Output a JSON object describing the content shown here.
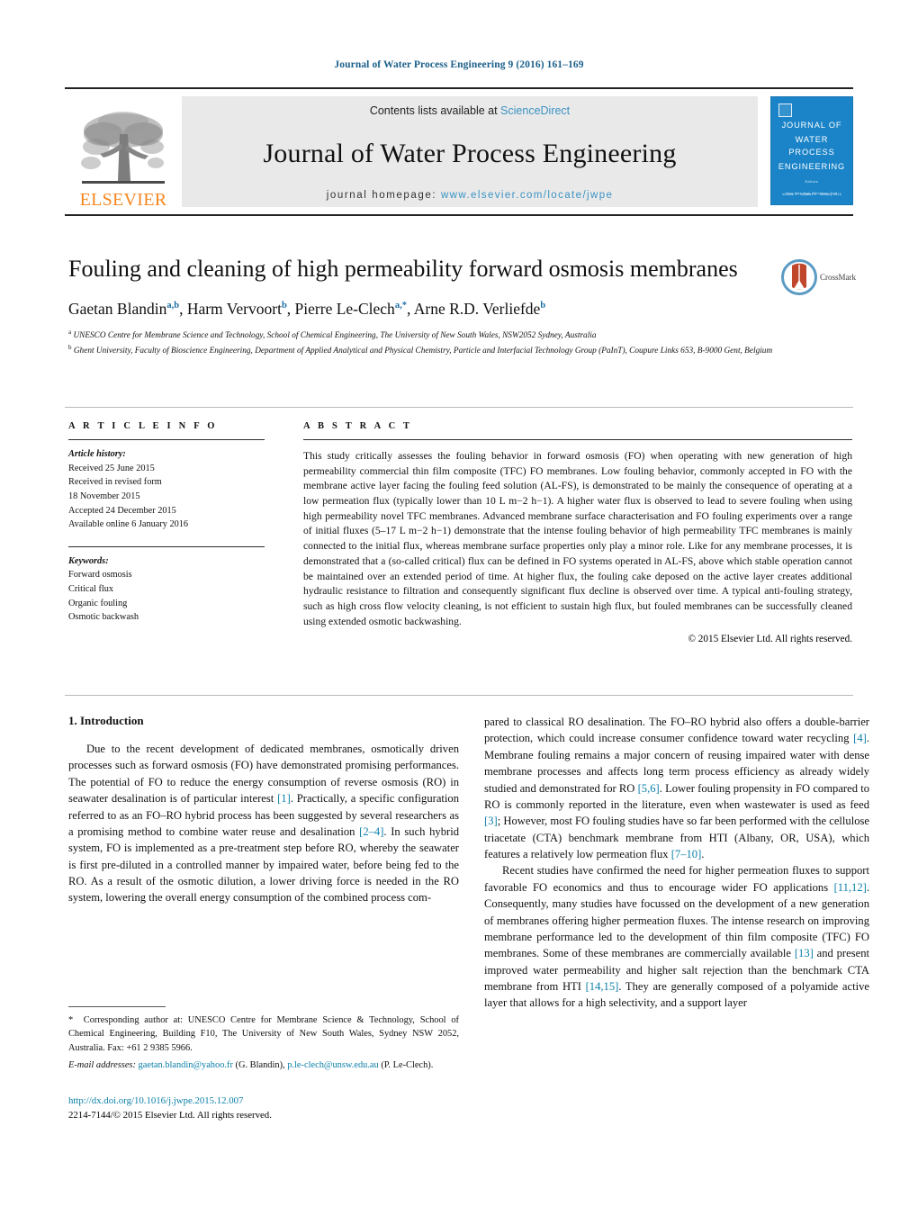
{
  "running_head": "Journal of Water Process Engineering 9 (2016) 161–169",
  "masthead": {
    "contents_prefix": "Contents lists available at ",
    "sciencedirect": "ScienceDirect",
    "journal_name": "Journal of Water Process Engineering",
    "homepage_label": "journal homepage:",
    "homepage_url": "www.elsevier.com/locate/jwpe",
    "publisher": "ELSEVIER",
    "publisher_logo_icon": "elsevier-tree-icon",
    "cover": {
      "title_line1": "JOURNAL OF",
      "title_line2": "WATER PROCESS",
      "title_line3": "ENGINEERING",
      "editors_label": "Editors",
      "editors": "Huu Hao Ngo    Wenshan Guo",
      "footer": "Volume 9 · Number 1 · January 2016"
    },
    "accent_blue": "#3a93c4",
    "cover_blue": "#1b84c8",
    "elsevier_orange": "#F6861F"
  },
  "article": {
    "title": "Fouling and cleaning of high permeability forward osmosis membranes",
    "authors_html": "Gaetan Blandin<sup>a,b</sup>, Harm Vervoort<sup>b</sup>, Pierre Le-Clech<sup>a,*</sup>, Arne R.D. Verliefde<sup>b</sup>",
    "affiliations": [
      "UNESCO Centre for Membrane Science and Technology, School of Chemical Engineering, The University of New South Wales, NSW2052 Sydney, Australia",
      "Ghent University, Faculty of Bioscience Engineering, Department of Applied Analytical and Physical Chemistry, Particle and Interfacial Technology Group (PaInT), Coupure Links 653, B-9000 Gent, Belgium"
    ],
    "crossmark_label": "CrossMark",
    "crossmark_icon": "crossmark-icon"
  },
  "article_info": {
    "heading": "A R T I C L E    I N F O",
    "history_label": "Article history:",
    "history": [
      "Received 25 June 2015",
      "Received in revised form",
      "18 November 2015",
      "Accepted 24 December 2015",
      "Available online 6 January 2016"
    ],
    "keywords_label": "Keywords:",
    "keywords": [
      "Forward osmosis",
      "Critical flux",
      "Organic fouling",
      "Osmotic backwash"
    ]
  },
  "abstract": {
    "heading": "A B S T R A C T",
    "text": "This study critically assesses the fouling behavior in forward osmosis (FO) when operating with new generation of high permeability commercial thin film composite (TFC) FO membranes. Low fouling behavior, commonly accepted in FO with the membrane active layer facing the fouling feed solution (AL-FS), is demonstrated to be mainly the consequence of operating at a low permeation flux (typically lower than 10 L m−2 h−1). A higher water flux is observed to lead to severe fouling when using high permeability novel TFC membranes. Advanced membrane surface characterisation and FO fouling experiments over a range of initial fluxes (5–17 L m−2 h−1) demonstrate that the intense fouling behavior of high permeability TFC membranes is mainly connected to the initial flux, whereas membrane surface properties only play a minor role. Like for any membrane processes, it is demonstrated that a (so-called critical) flux can be defined in FO systems operated in AL-FS, above which stable operation cannot be maintained over an extended period of time. At higher flux, the fouling cake deposed on the active layer creates additional hydraulic resistance to filtration and consequently significant flux decline is observed over time. A typical anti-fouling strategy, such as high cross flow velocity cleaning, is not efficient to sustain high flux, but fouled membranes can be successfully cleaned using extended osmotic backwashing.",
    "copyright": "© 2015 Elsevier Ltd. All rights reserved."
  },
  "introduction": {
    "heading": "1.  Introduction",
    "left_para1_html": "Due to the recent development of dedicated membranes, osmotically driven processes such as forward osmosis (FO) have demonstrated promising performances. The potential of FO to reduce the energy consumption of reverse osmosis (RO) in seawater desalination is of particular interest <span class=\"ref\">[1]</span>. Practically, a specific configuration referred to as an FO–RO hybrid process has been suggested by several researchers as a promising method to combine water reuse and desalination <span class=\"ref\">[2–4]</span>. In such hybrid system, FO is implemented as a pre-treatment step before RO, whereby the seawater is first pre-diluted in a controlled manner by impaired water, before being fed to the RO. As a result of the osmotic dilution, a lower driving force is needed in the RO system, lowering the overall energy consumption of the combined process com-",
    "right_para1_html": "pared to classical RO desalination. The FO–RO hybrid also offers a double-barrier protection, which could increase consumer confidence toward water recycling <span class=\"ref\">[4]</span>. Membrane fouling remains a major concern of reusing impaired water with dense membrane processes and affects long term process efficiency as already widely studied and demonstrated for RO <span class=\"ref\">[5,6]</span>. Lower fouling propensity in FO compared to RO is commonly reported in the literature, even when wastewater is used as feed <span class=\"ref\">[3]</span>; However, most FO fouling studies have so far been performed with the cellulose triacetate (CTA) benchmark membrane from HTI (Albany, OR, USA), which features a relatively low permeation flux <span class=\"ref\">[7–10]</span>.",
    "right_para2_html": "Recent studies have confirmed the need for higher permeation fluxes to support favorable FO economics and thus to encourage wider FO applications <span class=\"ref\">[11,12]</span>. Consequently, many studies have focussed on the development of a new generation of membranes offering higher permeation fluxes. The intense research on improving membrane performance led to the development of thin film composite (TFC) FO membranes. Some of these membranes are commercially available <span class=\"ref\">[13]</span> and present improved water permeability and higher salt rejection than the benchmark CTA membrane from HTI <span class=\"ref\">[14,15]</span>. They are generally composed of a polyamide active layer that allows for a high selectivity, and a support layer"
  },
  "footnote": {
    "corresponding_html": "<span class=\"star\">*</span>&nbsp; Corresponding author at: UNESCO Centre for Membrane Science &amp; Technology, School of Chemical Engineering, Building F10, The University of New South Wales, Sydney NSW 2052, Australia. Fax: +61 2 9385 5966.",
    "email_html": "<span class=\"lbl\">E-mail addresses:</span> <span class=\"link\">gaetan.blandin@yahoo.fr</span> (G. Blandin), <span class=\"link\">p.le-clech@unsw.edu.au</span> (P. Le-Clech).",
    "doi": "http://dx.doi.org/10.1016/j.jwpe.2015.12.007",
    "issn_line": "2214-7144/© 2015 Elsevier Ltd. All rights reserved."
  }
}
